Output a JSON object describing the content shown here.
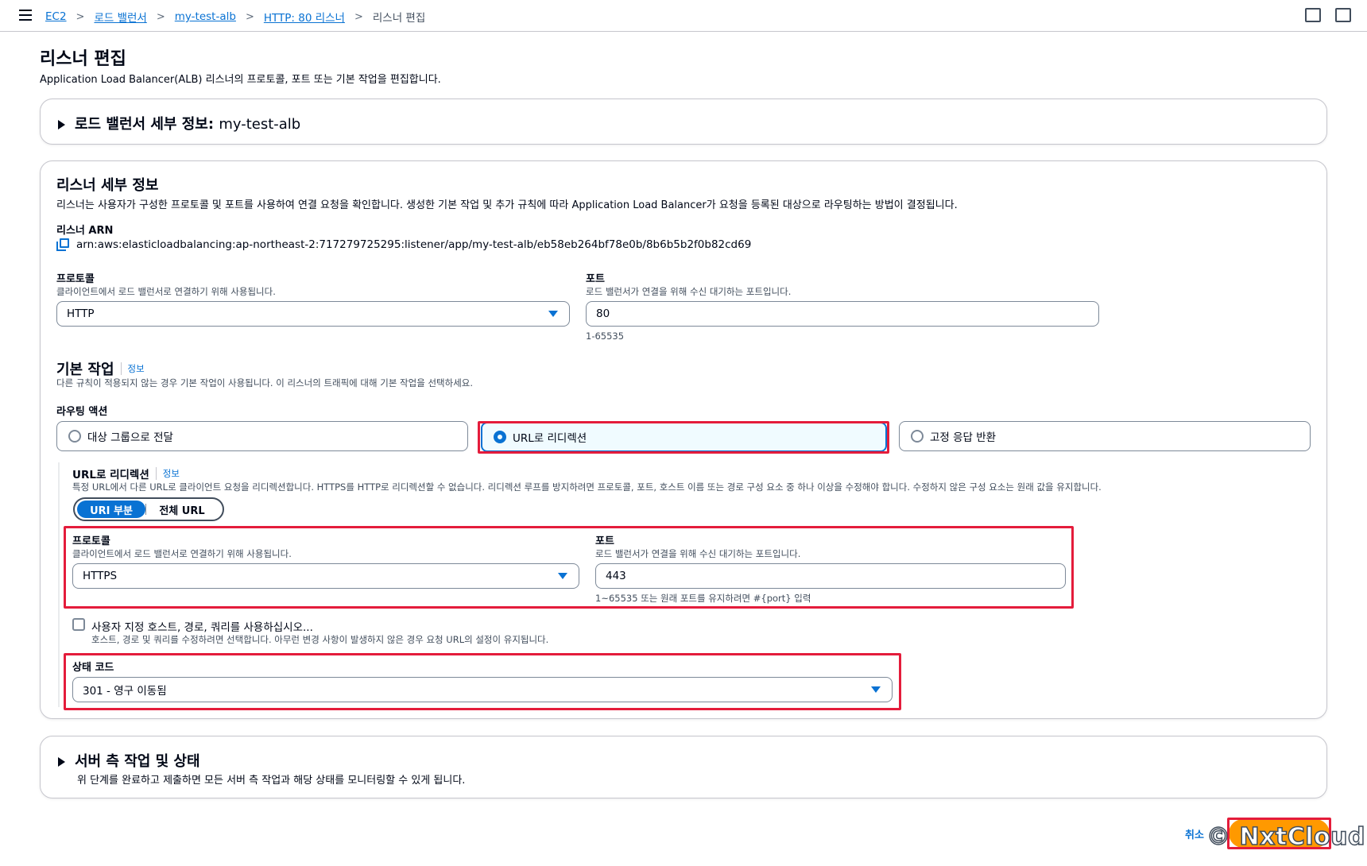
{
  "breadcrumb": {
    "items": [
      "EC2",
      "로드 밸런서",
      "my-test-alb",
      "HTTP: 80 리스너"
    ],
    "current": "리스너 편집"
  },
  "page": {
    "title": "리스너 편집",
    "description": "Application Load Balancer(ALB) 리스너의 프로토콜, 포트 또는 기본 작업을 편집합니다."
  },
  "lb_details": {
    "title_prefix": "로드 밸런서 세부 정보:",
    "title_name": "my-test-alb"
  },
  "listener": {
    "title": "리스너 세부 정보",
    "description": "리스너는 사용자가 구성한 프로토콜 및 포트를 사용하여 연결 요청을 확인합니다. 생성한 기본 작업 및 추가 규칙에 따라 Application Load Balancer가 요청을 등록된 대상으로 라우팅하는 방법이 결정됩니다.",
    "arn_label": "리스너 ARN",
    "arn": "arn:aws:elasticloadbalancing:ap-northeast-2:717279725295:listener/app/my-test-alb/eb58eb264bf78e0b/8b6b5b2f0b82cd69",
    "protocol_label": "프로토콜",
    "protocol_desc": "클라이언트에서 로드 밸런서로 연결하기 위해 사용됩니다.",
    "protocol_value": "HTTP",
    "port_label": "포트",
    "port_desc": "로드 밸런서가 연결을 위해 수신 대기하는 포트입니다.",
    "port_value": "80",
    "port_hint": "1-65535"
  },
  "default_action": {
    "title": "기본 작업",
    "info": "정보",
    "description": "다른 규칙이 적용되지 않는 경우 기본 작업이 사용됩니다. 이 리스너의 트래픽에 대해 기본 작업을 선택하세요.",
    "routing_label": "라우팅 액션",
    "options": [
      "대상 그룹으로 전달",
      "URL로 리디렉션",
      "고정 응답 반환"
    ],
    "selected_index": 1
  },
  "redirect": {
    "title": "URL로 리디렉션",
    "info": "정보",
    "description": "특정 URL에서 다른 URL로 클라이언트 요청을 리디렉션합니다. HTTPS를 HTTP로 리디렉션할 수 없습니다. 리디렉션 루프를 방지하려면 프로토콜, 포트, 호스트 이름 또는 경로 구성 요소 중 하나 이상을 수정해야 합니다. 수정하지 않은 구성 요소는 원래 값을 유지합니다.",
    "seg_active": "URI 부분",
    "seg_inactive": "전체 URL",
    "protocol_label": "프로토콜",
    "protocol_desc": "클라이언트에서 로드 밸런서로 연결하기 위해 사용됩니다.",
    "protocol_value": "HTTPS",
    "port_label": "포트",
    "port_desc": "로드 밸런서가 연결을 위해 수신 대기하는 포트입니다.",
    "port_value": "443",
    "port_hint": "1~65535 또는 원래 포트를 유지하려면 #{port} 입력",
    "custom_label": "사용자 지정 호스트, 경로, 쿼리를 사용하십시오...",
    "custom_desc": "호스트, 경로 및 쿼리를 수정하려면 선택합니다. 아무런 변경 사항이 발생하지 않은 경우 요청 URL의 설정이 유지됩니다.",
    "status_label": "상태 코드",
    "status_value": "301 - 영구 이동됨"
  },
  "server_side": {
    "title": "서버 측 작업 및 상태",
    "description": "위 단계를 완료하고 제출하면 모든 서버 측 작업과 해당 상태를 모니터링할 수 있게 됩니다."
  },
  "footer": {
    "cancel": "취소",
    "watermark": "© NxtCloud"
  },
  "colors": {
    "accent": "#0972d3",
    "highlight": "#e41c3b",
    "primary_button": "#ff9900"
  }
}
